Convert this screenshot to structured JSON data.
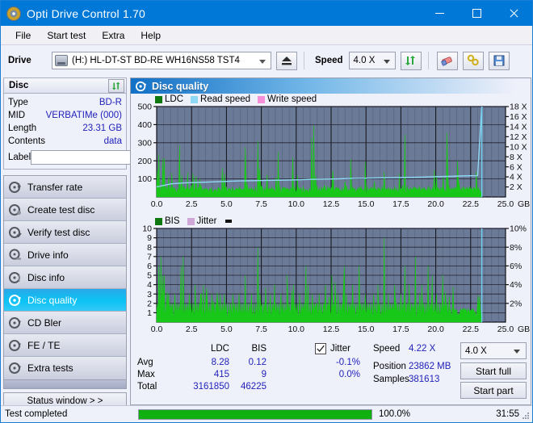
{
  "window": {
    "title": "Opti Drive Control 1.70",
    "icon": "disc-icon",
    "minimize": "minimize-icon",
    "maximize": "maximize-icon",
    "close": "close-icon"
  },
  "menu": {
    "items": [
      "File",
      "Start test",
      "Extra",
      "Help"
    ]
  },
  "toolbar": {
    "drive_label": "Drive",
    "drive_value": "(H:)  HL-DT-ST BD-RE  WH16NS58 TST4",
    "eject_icon": "eject-icon",
    "speed_label": "Speed",
    "speed_value": "4.0 X",
    "refresh_icon": "refresh-icon",
    "erase_icon": "eraser-icon",
    "tools_icon": "tools-icon",
    "save_icon": "save-icon"
  },
  "disc_panel": {
    "title": "Disc",
    "refresh_icon": "refresh-icon",
    "rows": [
      {
        "key": "Type",
        "value": "BD-R"
      },
      {
        "key": "MID",
        "value": "VERBATIMe (000)"
      },
      {
        "key": "Length",
        "value": "23.31 GB"
      },
      {
        "key": "Contents",
        "value": "data"
      }
    ],
    "label_key": "Label",
    "label_value": "",
    "label_placeholder": "",
    "label_button_icon": "disc-icon"
  },
  "nav": {
    "items": [
      {
        "label": "Transfer rate",
        "icon": "disc-transfer-icon",
        "active": false
      },
      {
        "label": "Create test disc",
        "icon": "disc-create-icon",
        "active": false
      },
      {
        "label": "Verify test disc",
        "icon": "disc-verify-icon",
        "active": false
      },
      {
        "label": "Drive info",
        "icon": "disc-drive-icon",
        "active": false
      },
      {
        "label": "Disc info",
        "icon": "disc-info-icon",
        "active": false
      },
      {
        "label": "Disc quality",
        "icon": "disc-quality-icon",
        "active": true
      },
      {
        "label": "CD Bler",
        "icon": "disc-bler-icon",
        "active": false
      },
      {
        "label": "FE / TE",
        "icon": "disc-fete-icon",
        "active": false
      },
      {
        "label": "Extra tests",
        "icon": "disc-extra-icon",
        "active": false
      }
    ],
    "status_window": "Status window > >"
  },
  "panel": {
    "header_title": "Disc quality",
    "header_icon": "disc-quality-icon"
  },
  "results": {
    "col_ldc": "LDC",
    "col_bis": "BIS",
    "rows": [
      {
        "key": "Avg",
        "ldc": "8.28",
        "bis": "0.12"
      },
      {
        "key": "Max",
        "ldc": "415",
        "bis": "9"
      },
      {
        "key": "Total",
        "ldc": "3161850",
        "bis": "46225"
      }
    ],
    "jitter_label": "Jitter",
    "jitter_checked": true,
    "jitter_values": [
      "-0.1%",
      "0.0%"
    ],
    "speed_key": "Speed",
    "speed_value": "4.22 X",
    "position_key": "Position",
    "position_value": "23862 MB",
    "samples_key": "Samples",
    "samples_value": "381613",
    "speed_select": "4.0 X",
    "start_full": "Start full",
    "start_part": "Start part"
  },
  "statusbar": {
    "text": "Test completed",
    "progress_pct": "100.0%",
    "progress_value": 100,
    "elapsed": "31:55"
  },
  "colors": {
    "accent": "#0078d7",
    "ldc_green": "#18b018",
    "dark_green": "#0a7a0a",
    "read_speed": "#8fd8f5",
    "write_speed": "#f58fd8",
    "jitter": "#cfa8d8",
    "plot_bg": "#6b7a96",
    "value_blue": "#2222bb",
    "progress_green": "#10b010"
  },
  "chart_data": [
    {
      "type": "area",
      "name": "ldc-chart",
      "title": "",
      "xlabel": "GB",
      "ylabel": "",
      "xlim": [
        0,
        25
      ],
      "ylim": [
        0,
        500
      ],
      "y2lim": [
        0,
        18
      ],
      "y2label": "X",
      "grid": true,
      "legend": [
        {
          "label": "LDC",
          "color": "#107810"
        },
        {
          "label": "Read speed",
          "color": "#8fd8f5"
        },
        {
          "label": "Write speed",
          "color": "#f58fd8"
        }
      ],
      "yticks": [
        100,
        200,
        300,
        400,
        500
      ],
      "y2ticks": [
        2,
        4,
        6,
        8,
        10,
        12,
        14,
        16,
        18
      ],
      "xticks": [
        "0.0",
        "2.5",
        "5.0",
        "7.5",
        "10.0",
        "12.5",
        "15.0",
        "17.5",
        "20.0",
        "22.5",
        "25.0"
      ],
      "xunit": "GB",
      "series": [
        {
          "name": "LDC",
          "color": "#18b018",
          "x": [
            0.05,
            0.15,
            0.3,
            0.45,
            0.55,
            0.7,
            0.8,
            0.95,
            1.05,
            1.2,
            1.35,
            1.5,
            1.65,
            1.8,
            1.95,
            2.1,
            2.25,
            2.35,
            2.45,
            2.6,
            2.75,
            2.9,
            3.05,
            3.2,
            3.35,
            3.5,
            3.65,
            3.8,
            3.95,
            4.1,
            4.25,
            4.4,
            4.55,
            4.7,
            4.85,
            5.0,
            5.15,
            5.3,
            5.45,
            5.6,
            5.75,
            5.9,
            6.05,
            6.2,
            6.35,
            6.5,
            6.65,
            6.8,
            6.95,
            7.1,
            7.25,
            7.4,
            7.55,
            7.7,
            7.85,
            8.0,
            8.1,
            8.25,
            8.4,
            8.55,
            8.7,
            8.85,
            9.0,
            9.15,
            9.3,
            9.45,
            9.6,
            9.75,
            9.9,
            10.05,
            10.2,
            10.35,
            10.5,
            10.65,
            10.8,
            10.95,
            11.1,
            11.25,
            11.4,
            11.5,
            11.65,
            11.8,
            11.95,
            12.1,
            12.25,
            12.4,
            12.55,
            12.7,
            12.85,
            13.0,
            13.15,
            13.3,
            13.45,
            13.6,
            13.75,
            13.9,
            14.05,
            14.2,
            14.35,
            14.5,
            14.65,
            14.8,
            14.95,
            15.1,
            15.25,
            15.4,
            15.55,
            15.7,
            15.85,
            16.0,
            16.15,
            16.3,
            16.45,
            16.6,
            16.75,
            16.9,
            17.05,
            17.2,
            17.35,
            17.5,
            17.65,
            17.8,
            17.95,
            18.1,
            18.25,
            18.4,
            18.55,
            18.7,
            18.85,
            19.0,
            19.15,
            19.3,
            19.45,
            19.6,
            19.75,
            19.9,
            20.05,
            20.2,
            20.35,
            20.5,
            20.65,
            20.8,
            20.95,
            21.1,
            21.25,
            21.4,
            21.55,
            21.7,
            21.85,
            22.0,
            22.15,
            22.3,
            22.45,
            22.6,
            22.75,
            22.9,
            23.05,
            23.2,
            23.3
          ],
          "y": [
            155,
            235,
            60,
            215,
            212,
            55,
            48,
            42,
            60,
            50,
            38,
            45,
            285,
            120,
            60,
            45,
            52,
            40,
            58,
            130,
            48,
            40,
            55,
            62,
            45,
            38,
            40,
            48,
            42,
            38,
            44,
            50,
            42,
            160,
            130,
            55,
            48,
            42,
            50,
            40,
            46,
            58,
            42,
            38,
            275,
            70,
            48,
            52,
            42,
            60,
            310,
            120,
            60,
            45,
            50,
            42,
            48,
            55,
            40,
            110,
            250,
            60,
            48,
            52,
            44,
            40,
            50,
            220,
            60,
            42,
            48,
            52,
            60,
            44,
            40,
            50,
            330,
            395,
            120,
            60,
            48,
            55,
            42,
            40,
            60,
            50,
            48,
            42,
            55,
            44,
            40,
            52,
            48,
            60,
            42,
            210,
            55,
            48,
            40,
            52,
            60,
            44,
            195,
            60,
            48,
            55,
            40,
            46,
            52,
            48,
            60,
            140,
            45,
            55,
            48,
            42,
            60,
            50,
            44,
            48,
            52,
            345,
            60,
            48,
            42,
            55,
            50,
            44,
            60,
            48,
            52,
            42,
            58,
            50,
            44,
            150,
            120,
            48,
            52,
            60,
            44,
            355,
            60,
            48,
            52,
            42,
            200,
            60,
            48,
            55,
            42,
            50,
            60,
            48,
            52,
            140,
            50,
            0,
            0,
            0
          ]
        },
        {
          "name": "Read speed",
          "color": "#8fd8f5",
          "x": [
            0.0,
            1.0,
            2.0,
            3.0,
            4.0,
            5.0,
            6.0,
            7.0,
            8.0,
            9.0,
            10.0,
            11.0,
            12.0,
            13.0,
            14.0,
            15.0,
            16.0,
            17.0,
            18.0,
            19.0,
            20.0,
            21.0,
            22.0,
            23.0,
            23.3
          ],
          "y": [
            2.0,
            2.6,
            2.8,
            2.9,
            3.0,
            3.1,
            3.2,
            3.25,
            3.3,
            3.35,
            3.4,
            3.5,
            3.55,
            3.6,
            3.7,
            3.75,
            3.8,
            3.85,
            3.9,
            3.95,
            4.05,
            4.1,
            4.2,
            4.25,
            18.0
          ]
        }
      ]
    },
    {
      "type": "area",
      "name": "bis-chart",
      "title": "",
      "xlabel": "GB",
      "ylabel": "",
      "xlim": [
        0,
        25
      ],
      "ylim": [
        0,
        10
      ],
      "y2lim": [
        0,
        10
      ],
      "y2label": "%",
      "grid": true,
      "legend": [
        {
          "label": "BIS",
          "color": "#107810"
        },
        {
          "label": "Jitter",
          "color": "#cfa8d8"
        }
      ],
      "yticks": [
        1,
        2,
        3,
        4,
        5,
        6,
        7,
        8,
        9,
        10
      ],
      "y2ticks": [
        "2%",
        "4%",
        "6%",
        "8%",
        "10%"
      ],
      "xticks": [
        "0.0",
        "2.5",
        "5.0",
        "7.5",
        "10.0",
        "12.5",
        "15.0",
        "17.5",
        "20.0",
        "22.5",
        "25.0"
      ],
      "xunit": "GB",
      "series": [
        {
          "name": "BIS",
          "color": "#18b018",
          "x": [
            0.05,
            0.15,
            0.3,
            0.45,
            0.55,
            0.7,
            0.85,
            1.0,
            1.15,
            1.3,
            1.45,
            1.6,
            1.75,
            1.9,
            2.05,
            2.2,
            2.35,
            2.45,
            2.6,
            2.75,
            2.9,
            3.05,
            3.2,
            3.35,
            3.5,
            3.65,
            3.8,
            3.95,
            4.1,
            4.25,
            4.4,
            4.55,
            4.7,
            4.85,
            5.0,
            5.15,
            5.3,
            5.45,
            5.6,
            5.75,
            5.9,
            6.05,
            6.2,
            6.35,
            6.5,
            6.65,
            6.8,
            6.95,
            7.1,
            7.25,
            7.4,
            7.55,
            7.7,
            7.85,
            8.0,
            8.15,
            8.3,
            8.45,
            8.6,
            8.75,
            8.9,
            9.05,
            9.2,
            9.35,
            9.5,
            9.65,
            9.8,
            9.95,
            10.1,
            10.25,
            10.4,
            10.55,
            10.7,
            10.85,
            11.0,
            11.15,
            11.3,
            11.45,
            11.5,
            11.65,
            11.8,
            11.95,
            12.1,
            12.25,
            12.4,
            12.55,
            12.7,
            12.85,
            13.0,
            13.15,
            13.3,
            13.45,
            13.6,
            13.75,
            13.9,
            14.05,
            14.2,
            14.35,
            14.5,
            14.65,
            14.8,
            14.95,
            15.1,
            15.25,
            15.4,
            15.55,
            15.7,
            15.85,
            16.0,
            16.15,
            16.3,
            16.45,
            16.6,
            16.75,
            16.9,
            17.05,
            17.2,
            17.35,
            17.5,
            17.65,
            17.8,
            17.95,
            18.1,
            18.25,
            18.4,
            18.55,
            18.7,
            18.85,
            19.0,
            19.15,
            19.3,
            19.45,
            19.6,
            19.75,
            19.9,
            20.05,
            20.2,
            20.35,
            20.5,
            20.65,
            20.8,
            20.95,
            21.1,
            21.25,
            21.4,
            21.55,
            21.7,
            21.85,
            22.0,
            22.15,
            22.3,
            22.45,
            22.6,
            22.75,
            22.9,
            23.05,
            23.2,
            23.3
          ],
          "y": [
            2,
            6,
            7,
            5,
            5,
            2,
            3,
            2,
            2,
            3,
            2,
            2,
            6,
            7,
            2,
            2,
            3,
            2,
            2,
            4,
            2,
            2,
            3,
            4,
            2,
            2,
            2,
            3,
            2,
            2,
            2,
            3,
            2,
            3,
            2,
            2,
            2,
            3,
            2,
            2,
            3,
            2,
            2,
            5,
            2,
            2,
            3,
            2,
            2,
            8,
            3,
            2,
            2,
            2,
            2,
            3,
            2,
            4,
            2,
            2,
            3,
            2,
            2,
            5,
            2,
            2,
            4,
            2,
            2,
            3,
            2,
            2,
            6,
            4,
            2,
            3,
            2,
            2,
            2,
            3,
            2,
            2,
            4,
            2,
            2,
            5,
            2,
            2,
            3,
            2,
            2,
            6,
            3,
            2,
            2,
            4,
            2,
            2,
            6,
            2,
            2,
            3,
            2,
            2,
            2,
            3,
            2,
            4,
            2,
            2,
            9,
            2,
            3,
            2,
            2,
            4,
            2,
            2,
            3,
            2,
            6,
            2,
            4,
            2,
            2,
            7,
            2,
            3,
            4,
            2,
            2,
            6,
            2,
            5,
            2,
            3,
            2,
            2,
            5,
            2,
            2,
            0,
            0,
            0,
            0,
            0,
            0,
            0,
            0,
            0,
            0,
            0,
            0,
            0,
            0,
            0,
            0,
            0
          ]
        }
      ]
    }
  ]
}
